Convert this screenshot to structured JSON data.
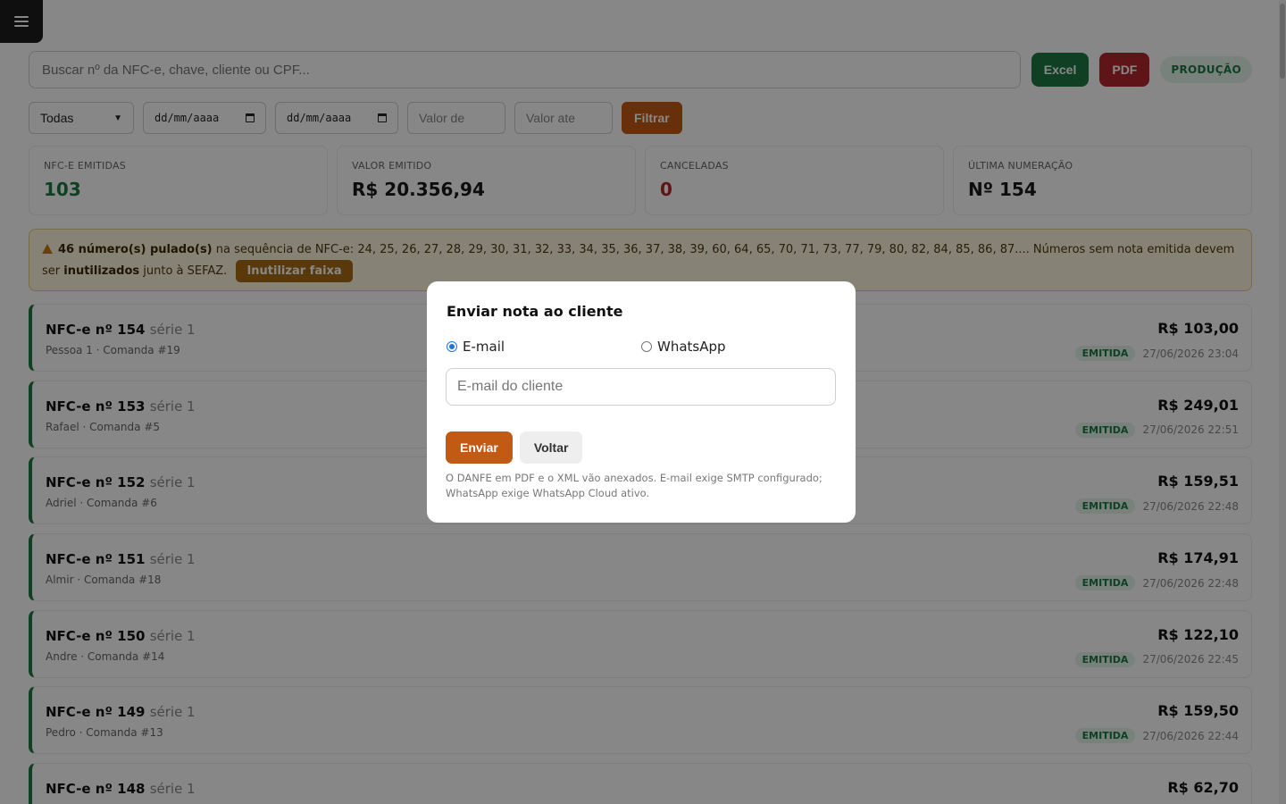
{
  "menu": {
    "icon": "hamburger-menu-icon"
  },
  "toolbar": {
    "search_placeholder": "Buscar nº da NFC-e, chave, cliente ou CPF...",
    "excel_label": "Excel",
    "pdf_label": "PDF",
    "env_badge": "PRODUÇÃO"
  },
  "filters": {
    "status_selected": "Todas",
    "date_from_placeholder": "dd/mm/aaaa",
    "date_to_placeholder": "dd/mm/aaaa",
    "value_from_placeholder": "Valor de",
    "value_to_placeholder": "Valor ate",
    "filter_label": "Filtrar"
  },
  "stats": [
    {
      "label": "NFC-e emitidas",
      "value": "103"
    },
    {
      "label": "Valor emitido",
      "value": "R$ 20.356,94"
    },
    {
      "label": "Canceladas",
      "value": "0"
    },
    {
      "label": "Última numeração",
      "value": "Nº 154"
    }
  ],
  "alert": {
    "count_text": "46 número(s) pulado(s)",
    "middle_text": " na sequência de NFC-e: 24, 25, 26, 27, 28, 29, 30, 31, 32, 33, 34, 35, 36, 37, 38, 39, 60, 64, 65, 70, 71, 73, 77, 79, 80, 82, 84, 85, 86, 87.... Números sem nota emitida devem ser ",
    "strong_text": "inutilizados",
    "end_text": " junto à SEFAZ.",
    "button_label": "Inutilizar faixa"
  },
  "notes": [
    {
      "title": "NFC-e nº 154",
      "serie": "série 1",
      "subtitle": "Pessoa 1 · Comanda #19",
      "amount": "R$ 103,00",
      "status": "EMITIDA",
      "date": "27/06/2026 23:04"
    },
    {
      "title": "NFC-e nº 153",
      "serie": "série 1",
      "subtitle": "Rafael · Comanda #5",
      "amount": "R$ 249,01",
      "status": "EMITIDA",
      "date": "27/06/2026 22:51"
    },
    {
      "title": "NFC-e nº 152",
      "serie": "série 1",
      "subtitle": "Adriel · Comanda #6",
      "amount": "R$ 159,51",
      "status": "EMITIDA",
      "date": "27/06/2026 22:48"
    },
    {
      "title": "NFC-e nº 151",
      "serie": "série 1",
      "subtitle": "Almir · Comanda #18",
      "amount": "R$ 174,91",
      "status": "EMITIDA",
      "date": "27/06/2026 22:48"
    },
    {
      "title": "NFC-e nº 150",
      "serie": "série 1",
      "subtitle": "Andre · Comanda #14",
      "amount": "R$ 122,10",
      "status": "EMITIDA",
      "date": "27/06/2026 22:45"
    },
    {
      "title": "NFC-e nº 149",
      "serie": "série 1",
      "subtitle": "Pedro · Comanda #13",
      "amount": "R$ 159,50",
      "status": "EMITIDA",
      "date": "27/06/2026 22:44"
    },
    {
      "title": "NFC-e nº 148",
      "serie": "série 1",
      "subtitle": "",
      "amount": "R$ 62,70",
      "status": "",
      "date": ""
    }
  ],
  "modal": {
    "title": "Enviar nota ao cliente",
    "option_email": "E-mail",
    "option_whatsapp": "WhatsApp",
    "email_placeholder": "E-mail do cliente",
    "send_label": "Enviar",
    "back_label": "Voltar",
    "note": "O DANFE em PDF e o XML vão anexados. E-mail exige SMTP configurado; WhatsApp exige WhatsApp Cloud ativo."
  },
  "colors": {
    "accent": "#c25a14",
    "success": "#1f7a45",
    "danger": "#b3262c",
    "warning_bg": "#fff6df"
  }
}
